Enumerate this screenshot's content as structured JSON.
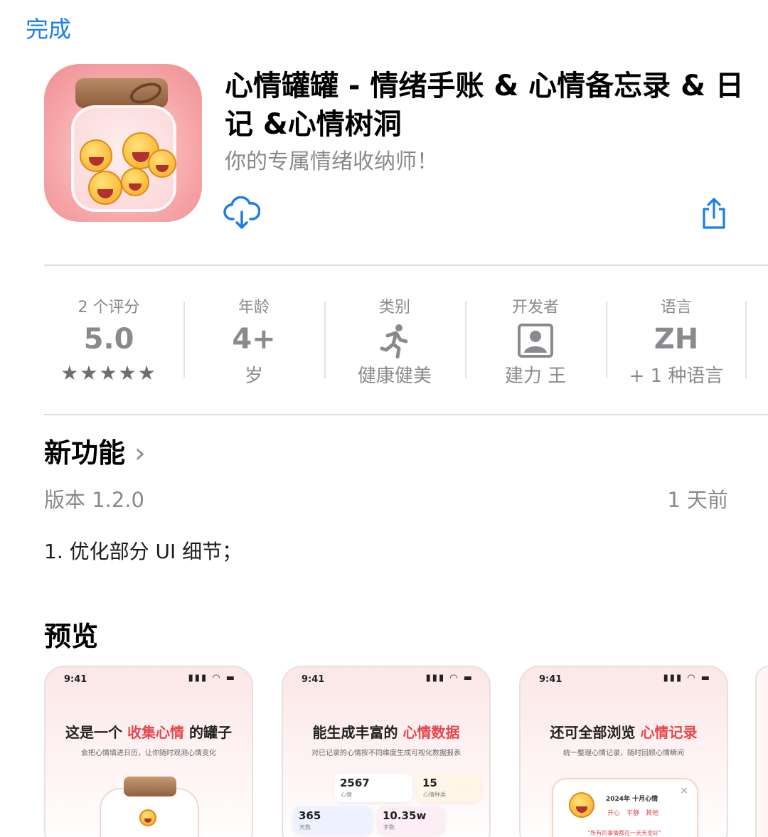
{
  "nav": {
    "done_label": "完成"
  },
  "app": {
    "title": "心情罐罐 - 情绪手账 & 心情备忘录 & 日记 &心情树洞",
    "subtitle": "你的专属情绪收纳师！",
    "icon": "mood-jar-app-icon"
  },
  "actions": {
    "download_icon": "cloud-download-icon",
    "share_icon": "share-icon"
  },
  "info": [
    {
      "label": "2 个评分",
      "value": "5.0",
      "sub": "★★★★★",
      "kind": "rating"
    },
    {
      "label": "年龄",
      "value": "4+",
      "sub": "岁"
    },
    {
      "label": "类别",
      "icon": "running-person-icon",
      "sub": "健康健美"
    },
    {
      "label": "开发者",
      "icon": "person-badge-icon",
      "sub": "建力 王"
    },
    {
      "label": "语言",
      "value": "ZH",
      "sub": "+ 1 种语言"
    }
  ],
  "whats_new": {
    "title": "新功能",
    "chevron": "›",
    "version": "版本 1.2.0",
    "time_ago": "1 天前",
    "notes": "1. 优化部分 UI 细节；"
  },
  "preview": {
    "title": "预览",
    "screens": [
      {
        "time": "9:41",
        "head_pre": "这是一个 ",
        "head_hl": "收集心情",
        "head_post": " 的罐子",
        "desc": "会把心情填进日历，让你随时观测心情变化"
      },
      {
        "time": "9:41",
        "head_pre": "能生成丰富的 ",
        "head_hl": "心情数据",
        "head_post": "",
        "desc": "对已记录的心情按不同维度生成可视化数据报表",
        "stats": [
          {
            "num": "2567",
            "lbl": "心情"
          },
          {
            "num": "15",
            "lbl": "心情种类"
          },
          {
            "num": "365",
            "lbl": "天数"
          },
          {
            "num": "10.35w",
            "lbl": "字数"
          }
        ]
      },
      {
        "time": "9:41",
        "head_pre": "还可全部浏览 ",
        "head_hl": "心情记录",
        "head_post": "",
        "desc": "统一整理心情记录，随时回顾心情瞬间",
        "card_title": "2024年 十月心情",
        "card_tabs": "开心　平静　其他",
        "card_quote": "“所有的事情都在一天天变好”",
        "card_close": "×"
      }
    ]
  },
  "colors": {
    "accent": "#1a7fe8",
    "highlight": "#e5484d",
    "secondary_text": "#8a8a8e"
  }
}
